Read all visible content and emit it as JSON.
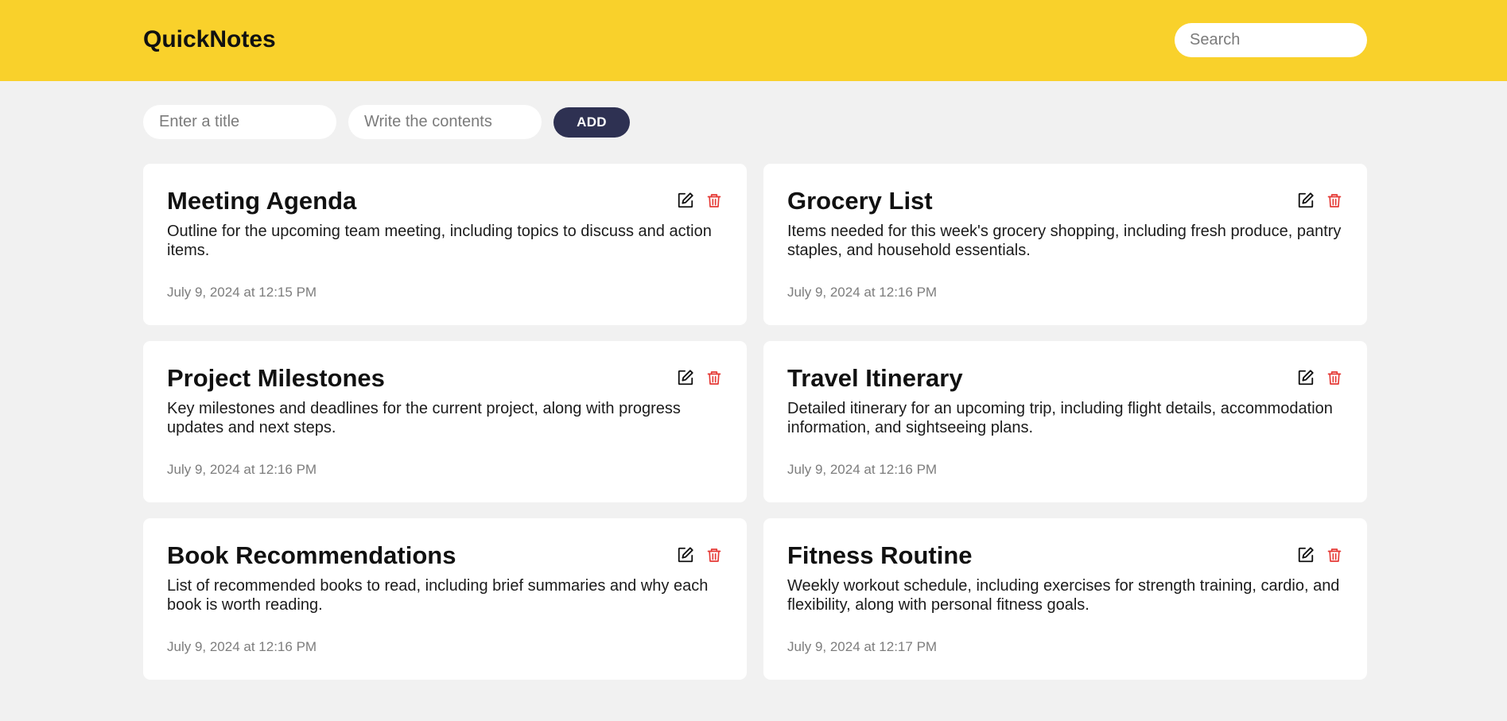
{
  "header": {
    "brand": "QuickNotes",
    "search_placeholder": "Search",
    "background_color": "#f9d12b"
  },
  "composer": {
    "title_placeholder": "Enter a title",
    "contents_placeholder": "Write the contents",
    "add_label": "ADD",
    "button_color": "#2e3152"
  },
  "icons": {
    "edit": "edit-icon",
    "delete": "trash-icon",
    "delete_color": "#e53935"
  },
  "notes": [
    {
      "title": "Meeting Agenda",
      "body": "Outline for the upcoming team meeting, including topics to discuss and action items.",
      "date": "July 9, 2024 at 12:15 PM"
    },
    {
      "title": "Grocery List",
      "body": "Items needed for this week's grocery shopping, including fresh produce, pantry staples, and household essentials.",
      "date": "July 9, 2024 at 12:16 PM"
    },
    {
      "title": "Project Milestones",
      "body": "Key milestones and deadlines for the current project, along with progress updates and next steps.",
      "date": "July 9, 2024 at 12:16 PM"
    },
    {
      "title": "Travel Itinerary",
      "body": "Detailed itinerary for an upcoming trip, including flight details, accommodation information, and sightseeing plans.",
      "date": "July 9, 2024 at 12:16 PM"
    },
    {
      "title": "Book Recommendations",
      "body": "List of recommended books to read, including brief summaries and why each book is worth reading.",
      "date": "July 9, 2024 at 12:16 PM"
    },
    {
      "title": "Fitness Routine",
      "body": "Weekly workout schedule, including exercises for strength training, cardio, and flexibility, along with personal fitness goals.",
      "date": "July 9, 2024 at 12:17 PM"
    }
  ]
}
